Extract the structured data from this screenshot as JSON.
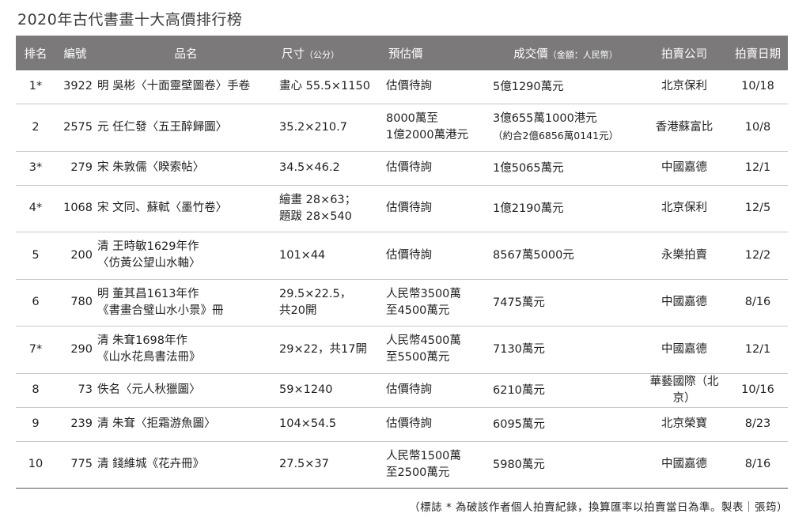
{
  "title": "2020年古代書畫十大高價排行榜",
  "headers": {
    "rank": "排名",
    "lot": "編號",
    "item": "品名",
    "size": "尺寸",
    "size_unit": "（公分）",
    "estimate": "預估價",
    "price": "成交價",
    "price_unit": "（金額：人民幣）",
    "house": "拍賣公司",
    "date": "拍賣日期"
  },
  "rows": [
    {
      "rank": "1*",
      "lot": "3922",
      "item1": "明 吳彬〈十面靈壁圖卷〉手卷",
      "item2": "",
      "size1": "畫心 55.5×1150",
      "size2": "",
      "est1": "估價待詢",
      "est2": "",
      "price1": "5億1290萬元",
      "price2": "",
      "house": "北京保利",
      "date": "10/18"
    },
    {
      "rank": "2",
      "lot": "2575",
      "item1": "元 任仁發〈五王醉歸圖〉",
      "item2": "",
      "size1": "35.2×210.7",
      "size2": "",
      "est1": "8000萬至",
      "est2": "1億2000萬港元",
      "price1": "3億655萬1000港元",
      "price2": "（約合2億6856萬0141元）",
      "house": "香港蘇富比",
      "date": "10/8"
    },
    {
      "rank": "3*",
      "lot": "279",
      "item1": "宋 朱敦儒〈睽索帖〉",
      "item2": "",
      "size1": "34.5×46.2",
      "size2": "",
      "est1": "估價待詢",
      "est2": "",
      "price1": "1億5065萬元",
      "price2": "",
      "house": "中國嘉德",
      "date": "12/1"
    },
    {
      "rank": "4*",
      "lot": "1068",
      "item1": "宋 文同、蘇軾〈墨竹卷〉",
      "item2": "",
      "size1": "繪畫 28×63；",
      "size2": "題跋 28×540",
      "est1": "估價待詢",
      "est2": "",
      "price1": "1億2190萬元",
      "price2": "",
      "house": "北京保利",
      "date": "12/5"
    },
    {
      "rank": "5",
      "lot": "200",
      "item1": "清 王時敏1629年作",
      "item2": "〈仿黃公望山水軸〉",
      "size1": "101×44",
      "size2": "",
      "est1": "估價待詢",
      "est2": "",
      "price1": "8567萬5000元",
      "price2": "",
      "house": "永樂拍賣",
      "date": "12/2"
    },
    {
      "rank": "6",
      "lot": "780",
      "item1": "明 董其昌1613年作",
      "item2": "《書畫合璧山水小景》冊",
      "size1": "29.5×22.5，",
      "size2": "共20開",
      "est1": "人民幣3500萬",
      "est2": "至4500萬元",
      "price1": "7475萬元",
      "price2": "",
      "house": "中國嘉德",
      "date": "8/16"
    },
    {
      "rank": "7*",
      "lot": "290",
      "item1": "清 朱耷1698年作",
      "item2": "《山水花鳥書法冊》",
      "size1": "29×22，共17開",
      "size2": "",
      "est1": "人民幣4500萬",
      "est2": "至5500萬元",
      "price1": "7130萬元",
      "price2": "",
      "house": "中國嘉德",
      "date": "12/1"
    },
    {
      "rank": "8",
      "lot": "73",
      "item1": "佚名〈元人秋獵圖〉",
      "item2": "",
      "size1": "59×1240",
      "size2": "",
      "est1": "估價待詢",
      "est2": "",
      "price1": "6210萬元",
      "price2": "",
      "house": "華藝國際（北京）",
      "date": "10/16"
    },
    {
      "rank": "9",
      "lot": "239",
      "item1": "清 朱耷〈拒霜游魚圖〉",
      "item2": "",
      "size1": "104×54.5",
      "size2": "",
      "est1": "估價待詢",
      "est2": "",
      "price1": "6095萬元",
      "price2": "",
      "house": "北京榮寶",
      "date": "8/23"
    },
    {
      "rank": "10",
      "lot": "775",
      "item1": "清 錢維城《花卉冊》",
      "item2": "",
      "size1": "27.5×37",
      "size2": "",
      "est1": "人民幣1500萬",
      "est2": "至2500萬元",
      "price1": "5980萬元",
      "price2": "",
      "house": "中國嘉德",
      "date": "8/16"
    }
  ],
  "footnote": "（標誌 * 為破該作者個人拍賣紀錄，換算匯率以拍賣當日為準。製表｜張筠）"
}
